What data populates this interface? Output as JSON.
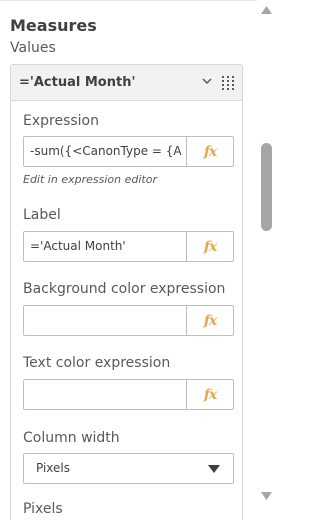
{
  "panel": {
    "heading": "Measures",
    "subheading": "Values"
  },
  "measure_card": {
    "title": "='Actual Month'",
    "chevron_icon": "chevron-down-icon",
    "drag_icon": "drag-handle-icon"
  },
  "expression": {
    "label": "Expression",
    "value": "-sum({<CanonType = {Ac",
    "hint": "Edit in expression editor",
    "fx_label": "fx"
  },
  "label_field": {
    "label": "Label",
    "value": "='Actual Month'",
    "fx_label": "fx"
  },
  "background_color": {
    "label": "Background color expression",
    "value": "",
    "fx_label": "fx"
  },
  "text_color": {
    "label": "Text color expression",
    "value": "",
    "fx_label": "fx"
  },
  "column_width": {
    "label": "Column width",
    "selected": "Pixels"
  },
  "pixels_label": "Pixels",
  "colors": {
    "fx": "#e8a64b",
    "card_header_bg": "#f2f2f2",
    "scroll_thumb": "#a6a6a6"
  }
}
